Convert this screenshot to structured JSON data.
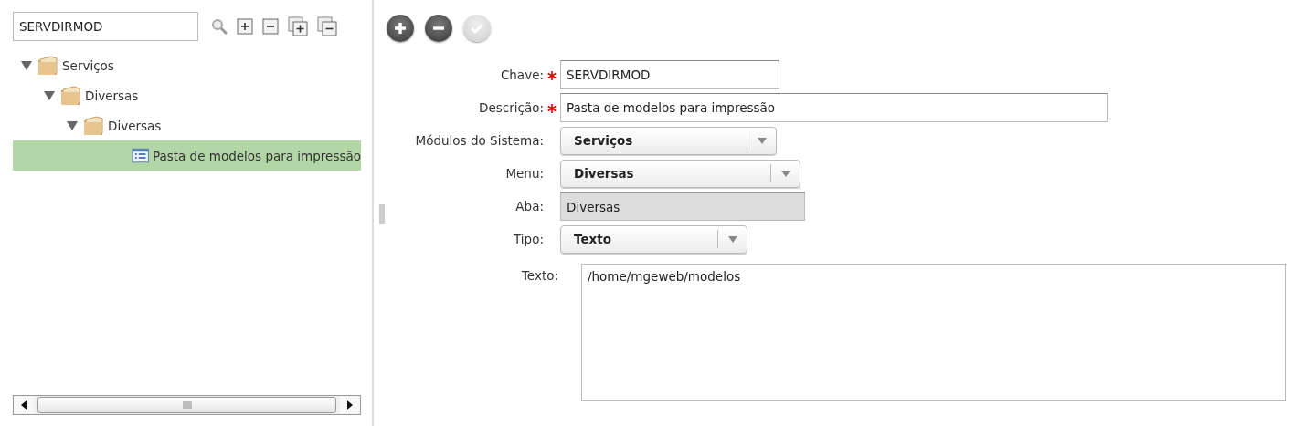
{
  "search": {
    "value": "SERVDIRMOD"
  },
  "tree_tools": [
    {
      "kind": "search"
    },
    {
      "kind": "expand"
    },
    {
      "kind": "collapse"
    },
    {
      "kind": "expand_all"
    },
    {
      "kind": "collapse_all"
    }
  ],
  "tree": [
    {
      "label": "Serviços",
      "kind": "folder",
      "expanded": true,
      "selected": false,
      "children": [
        {
          "label": "Diversas",
          "kind": "folder",
          "expanded": true,
          "selected": false,
          "children": [
            {
              "label": "Diversas",
              "kind": "folder",
              "expanded": true,
              "selected": false,
              "children": [
                {
                  "label": "Pasta de modelos para impressão",
                  "kind": "item",
                  "selected": true
                }
              ]
            }
          ]
        }
      ]
    }
  ],
  "toolbar": [
    {
      "kind": "add",
      "disabled": false
    },
    {
      "kind": "remove",
      "disabled": false
    },
    {
      "kind": "confirm",
      "disabled": true
    }
  ],
  "fields": [
    {
      "label": "Chave:",
      "kind": "text",
      "required": true,
      "value": "SERVDIRMOD"
    },
    {
      "label": "Descrição:",
      "kind": "text",
      "required": true,
      "value": "Pasta de modelos para impressão"
    },
    {
      "label": "Módulos do Sistema:",
      "kind": "select",
      "required": false,
      "value": "Serviços"
    },
    {
      "label": "Menu:",
      "kind": "select",
      "required": false,
      "value": "Diversas"
    },
    {
      "label": "Aba:",
      "kind": "readonly",
      "required": false,
      "value": "Diversas"
    },
    {
      "label": "Tipo:",
      "kind": "select",
      "required": false,
      "value": "Texto"
    },
    {
      "label": "Texto:",
      "kind": "textarea",
      "required": false,
      "value": "/home/mgeweb/modelos"
    }
  ]
}
